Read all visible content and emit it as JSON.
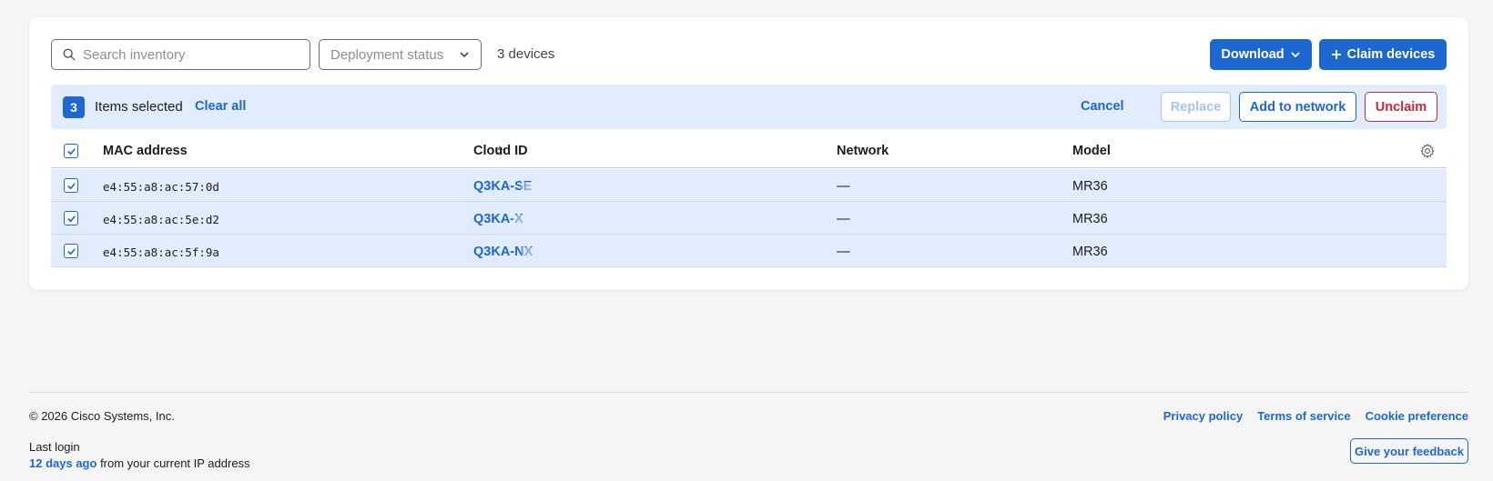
{
  "toolbar": {
    "search_placeholder": "Search inventory",
    "deployment_filter": "Deployment status",
    "device_count": "3 devices",
    "download_label": "Download",
    "claim_label": "Claim devices"
  },
  "selection": {
    "count": "3",
    "text": "Items selected",
    "clear_all": "Clear all",
    "cancel": "Cancel",
    "replace": "Replace",
    "add_to_network": "Add to network",
    "unclaim": "Unclaim"
  },
  "table": {
    "columns": [
      "MAC address",
      "Cloud ID",
      "Network",
      "Model"
    ],
    "rows": [
      {
        "mac": "e4:55:a8:ac:57:0d",
        "cloud_id": "Q3KA-SE",
        "network": "—",
        "model": "MR36",
        "checked": true
      },
      {
        "mac": "e4:55:a8:ac:5e:d2",
        "cloud_id": "Q3KA-X",
        "network": "—",
        "model": "MR36",
        "checked": true
      },
      {
        "mac": "e4:55:a8:ac:5f:9a",
        "cloud_id": "Q3KA-NX",
        "network": "—",
        "model": "MR36",
        "checked": true
      }
    ]
  },
  "footer": {
    "copyright": "© 2026 Cisco Systems, Inc.",
    "links": [
      "Privacy policy",
      "Terms of service",
      "Cookie preference"
    ],
    "last_login_label": "Last login",
    "last_login_ago": "12 days ago",
    "last_login_suffix": "from your current IP address",
    "feedback": "Give your feedback"
  },
  "colors": {
    "accent": "#1d67d1",
    "danger": "#d0263a",
    "selected_row": "#e1ecfc"
  }
}
